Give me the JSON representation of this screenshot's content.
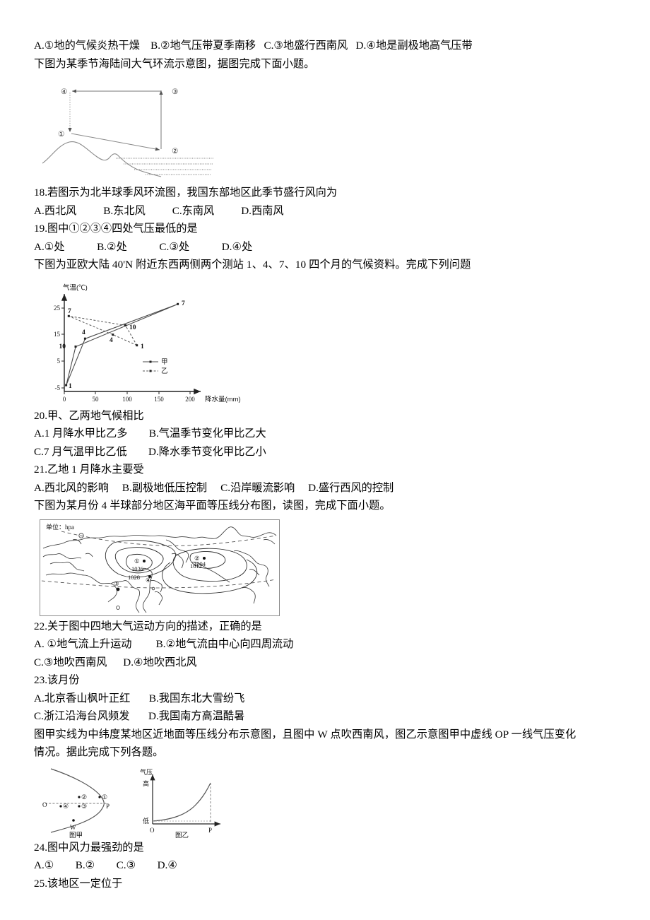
{
  "document": {
    "language": "zh-CN",
    "type": "geography-exam-worksheet"
  },
  "blocks": {
    "opts_q17": "A.①地的气候炎热干燥    B.②地气压带夏季南移   C.③地盛行西南风   D.④地是副极地高气压带",
    "intro_fig1": "下图为某季节海陆间大气环流示意图，据图完成下面小题。",
    "q18_stem": "18.若图示为北半球季风环流图，我国东部地区此季节盛行风向为",
    "q18_options": "A.西北风          B.东北风          C.东南风          D.西南风",
    "q19_stem": "19.图中①②③④四处气压最低的是",
    "q19_options": "A.①处            B.②处            C.③处            D.④处",
    "intro_fig2": "下图为亚欧大陆 40'N 附近东西两侧两个测站 1、4、7、10 四个月的气候资料。完成下列问题",
    "q20_stem": "20.甲、乙两地气候相比",
    "q20_opt_ab": "A.1 月降水甲比乙多        B.气温季节变化甲比乙大",
    "q20_opt_cd": "C.7 月气温甲比乙低        D.降水季节变化甲比乙小",
    "q21_stem": "21.乙地 1 月降水主要受",
    "q21_options": "A.西北风的影响     B.副极地低压控制     C.沿岸暖流影响     D.盛行西风的控制",
    "intro_fig3": "下图为某月份 4 半球部分地区海平面等压线分布图，读图，完成下面小题。",
    "q22_stem": "22.关于图中四地大气运动方向的描述，正确的是",
    "q22_opt_ab": "A. ①地气流上升运动         B.②地气流由中心向四周流动",
    "q22_opt_cd": "C.③地吹西南风      D.④地吹西北风",
    "q23_stem": "23.该月份",
    "q23_opt_ab": "A.北京香山枫叶正红       B.我国东北大雪纷飞",
    "q23_opt_cd": "C.浙江沿海台风频发       D.我国南方高温酷暑",
    "intro_fig4_l1": "图甲实线为中纬度某地区近地面等压线分布示意图，且图中 W 点吹西南风，图乙示意图甲中虚线 OP 一线气压变化",
    "intro_fig4_l2": "情况。据此完成下列各题。",
    "q24_stem": "24.图中风力最强劲的是",
    "q24_options": "A.①        B.②        C.③        D.④",
    "q25_stem": "25.该地区一定位于"
  },
  "figure1": {
    "name": "sea-land-atmospheric-circulation",
    "labels": {
      "p4": "④",
      "p3": "③",
      "p1": "①",
      "p2": "②"
    }
  },
  "chart_data": {
    "type": "scatter",
    "name": "climate-temperature-precipitation-chart",
    "title": "",
    "xlabel": "降水量(mm)",
    "ylabel": "气温(℃)",
    "xlim": [
      0,
      215
    ],
    "ylim": [
      -5,
      29
    ],
    "xticks": [
      0,
      50,
      100,
      150,
      200
    ],
    "yticks": [
      -5,
      5,
      15,
      25
    ],
    "grid": false,
    "legend_position": "inside-right",
    "series": [
      {
        "name": "甲",
        "style": "solid",
        "points": [
          {
            "label": "1",
            "x": 3,
            "y": -4.0
          },
          {
            "label": "4",
            "x": 33,
            "y": 13.5
          },
          {
            "label": "7",
            "x": 180,
            "y": 26.5
          },
          {
            "label": "10",
            "x": 18,
            "y": 10.5
          }
        ]
      },
      {
        "name": "乙",
        "style": "dashed",
        "points": [
          {
            "label": "1",
            "x": 115,
            "y": 11.0
          },
          {
            "label": "4",
            "x": 77,
            "y": 15.0
          },
          {
            "label": "7",
            "x": 7,
            "y": 22.0
          },
          {
            "label": "10",
            "x": 97,
            "y": 18.5
          }
        ]
      }
    ]
  },
  "figure3": {
    "name": "sea-level-isobar-map",
    "unit_label": "单位：hpa",
    "isobar_labels": [
      "1036",
      "1028",
      "1012",
      "1004"
    ],
    "point_labels": [
      "①",
      "②",
      "③",
      "④"
    ]
  },
  "figure4": {
    "jia": {
      "caption": "图甲",
      "labels": {
        "o": "O",
        "p": "P",
        "w": "W",
        "p1": "①",
        "p2": "②",
        "p3": "③",
        "p4": "④"
      }
    },
    "yi": {
      "caption": "图乙",
      "axis_label": "气压",
      "high": "高",
      "low": "低",
      "origin": "O",
      "end": "P"
    }
  }
}
